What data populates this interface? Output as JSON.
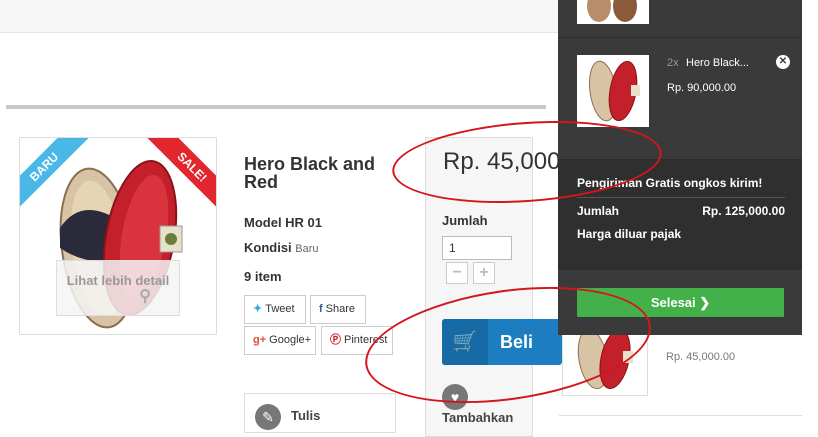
{
  "product": {
    "title": "Hero Black and Red",
    "badge_new": "BARU",
    "badge_sale": "SALE!",
    "detail_label": "Lihat lebih detail",
    "model_label": "Model HR 01",
    "condition_label": "Kondisi",
    "condition_value": "Baru",
    "quantity_label": "9 item",
    "price": "Rp. 45,000",
    "amount_label": "Jumlah",
    "amount_value": "1",
    "minus": "−",
    "plus": "+",
    "buy_label": "Beli",
    "write_label": "Tulis",
    "wishlist_label": "Tambahkan"
  },
  "social": {
    "tweet": "Tweet",
    "share": "Share",
    "gplus": "Google+",
    "pinterest": "Pinterest"
  },
  "side_list": {
    "price": "Rp. 45,000.00"
  },
  "cart": {
    "item_qty": "2x",
    "item_name": "Hero Black...",
    "item_price": "Rp. 90,000.00",
    "free_shipping": "Pengiriman Gratis ongkos kirim!",
    "total_label": "Jumlah",
    "total_value": "Rp. 125,000.00",
    "tax_note": "Harga diluar pajak",
    "checkout_label": "Selesai ❯"
  },
  "colors": {
    "accent_blue": "#1c7dc0",
    "checkout_green": "#43b04a",
    "cart_bg": "#3a3a3a",
    "annotation_red": "#d4161c"
  }
}
